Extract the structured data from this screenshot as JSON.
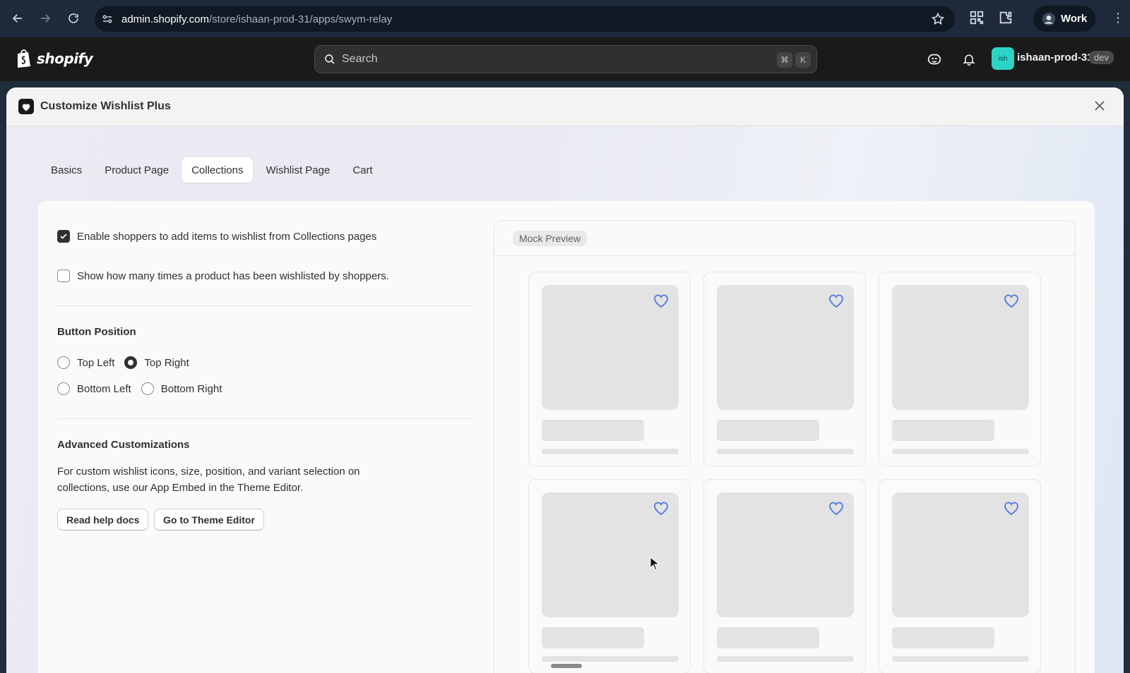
{
  "browser": {
    "url_host": "admin.shopify.com",
    "url_path": "/store/ishaan-prod-31/apps/swym-relay",
    "profile_label": "Work"
  },
  "shopify": {
    "logo_text": "shopify",
    "search_placeholder": "Search",
    "shortcut_mod": "⌘",
    "shortcut_key": "K",
    "store_avatar": "ish",
    "store_name": "ishaan-prod-31",
    "store_badge": "dev"
  },
  "modal": {
    "title": "Customize Wishlist Plus",
    "tabs": [
      {
        "label": "Basics"
      },
      {
        "label": "Product Page"
      },
      {
        "label": "Collections"
      },
      {
        "label": "Wishlist Page"
      },
      {
        "label": "Cart"
      }
    ],
    "active_tab": "Collections"
  },
  "settings": {
    "enable_collections": {
      "label": "Enable shoppers to add items to wishlist from Collections pages",
      "checked": true
    },
    "show_count": {
      "label": "Show how many times a product has been wishlisted by shoppers.",
      "checked": false
    },
    "button_position": {
      "title": "Button Position",
      "options": [
        "Top Left",
        "Top Right",
        "Bottom Left",
        "Bottom Right"
      ],
      "selected": "Top Right"
    },
    "advanced": {
      "title": "Advanced Customizations",
      "description": "For custom wishlist icons, size, position, and variant selection on collections, use our App Embed in the Theme Editor.",
      "help_button": "Read help docs",
      "theme_button": "Go to Theme Editor"
    }
  },
  "preview": {
    "badge": "Mock Preview",
    "card_count": 6
  },
  "colors": {
    "heart": "#5a7fdc",
    "placeholder": "#e3e3e3",
    "accent": "#303030"
  }
}
